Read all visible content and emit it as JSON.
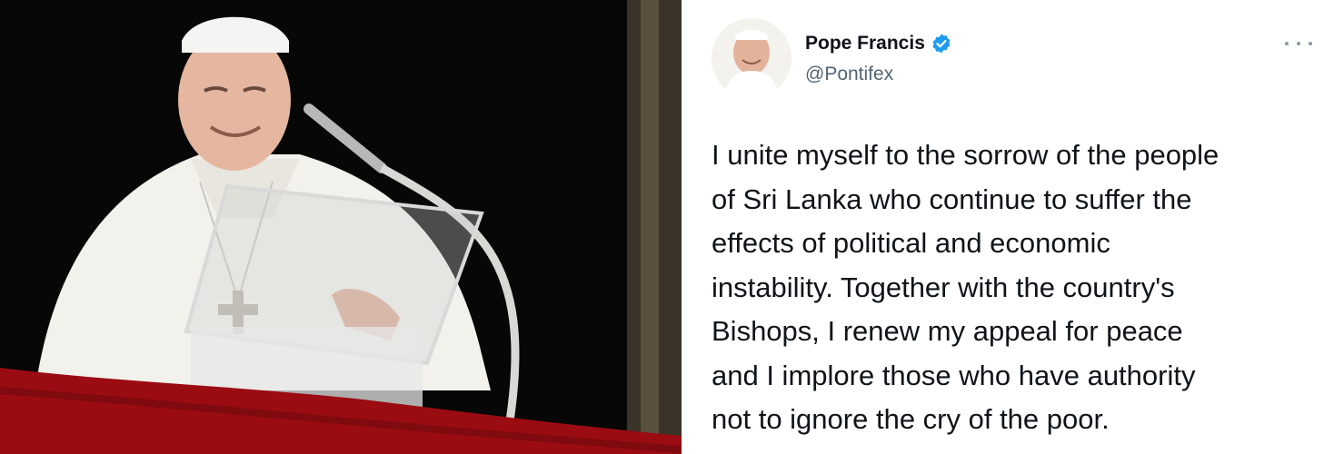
{
  "photo": {
    "alt_icon": "photo-pope-at-window",
    "colors": {
      "background": "#070707",
      "balcony_drape": "#9a0c12",
      "robe": "#f2f1ec"
    }
  },
  "tweet": {
    "author": {
      "display_name": "Pope Francis",
      "handle": "@Pontifex",
      "verified": true,
      "verified_color": "#1d9bf0"
    },
    "more_icon": "more-horizontal-icon",
    "text": "I unite myself to the sorrow of the people\nof Sri Lanka who continue to suffer the\neffects of political and economic\ninstability. Together with the country's\nBishops, I renew my appeal for peace\nand I implore those who have authority\nnot to ignore the cry of the poor."
  }
}
